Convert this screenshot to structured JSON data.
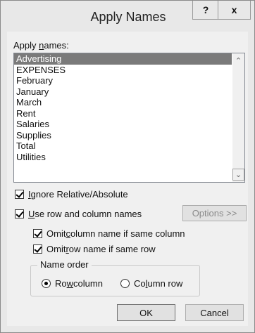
{
  "window": {
    "title": "Apply Names",
    "help_label": "?",
    "close_label": "x"
  },
  "apply_names": {
    "label_prefix": "Apply ",
    "label_underlined": "n",
    "label_suffix": "ames:",
    "items": [
      {
        "label": "Advertising",
        "selected": true
      },
      {
        "label": "EXPENSES",
        "selected": false
      },
      {
        "label": "February",
        "selected": false
      },
      {
        "label": "January",
        "selected": false
      },
      {
        "label": "March",
        "selected": false
      },
      {
        "label": "Rent",
        "selected": false
      },
      {
        "label": "Salaries",
        "selected": false
      },
      {
        "label": "Supplies",
        "selected": false
      },
      {
        "label": "Total",
        "selected": false
      },
      {
        "label": "Utilities",
        "selected": false
      }
    ]
  },
  "options": {
    "ignore_relative": {
      "underlined": "I",
      "rest": "gnore Relative/Absolute",
      "checked": true
    },
    "use_row_column": {
      "underlined": "U",
      "rest": "se row and column names",
      "checked": true
    },
    "omit_column": {
      "prefix": "Omit ",
      "underlined": "c",
      "rest": "olumn name if same column",
      "checked": true
    },
    "omit_row": {
      "prefix": "Omit ",
      "underlined": "r",
      "rest": "ow name if same row",
      "checked": true
    },
    "options_button": "Options >>"
  },
  "name_order": {
    "title": "Name order",
    "row_column": {
      "prefix": "Ro",
      "underlined": "w",
      "rest": " column",
      "selected": true
    },
    "column_row": {
      "prefix": "Co",
      "underlined": "l",
      "rest": "umn row",
      "selected": false
    }
  },
  "buttons": {
    "ok": "OK",
    "cancel": "Cancel"
  }
}
